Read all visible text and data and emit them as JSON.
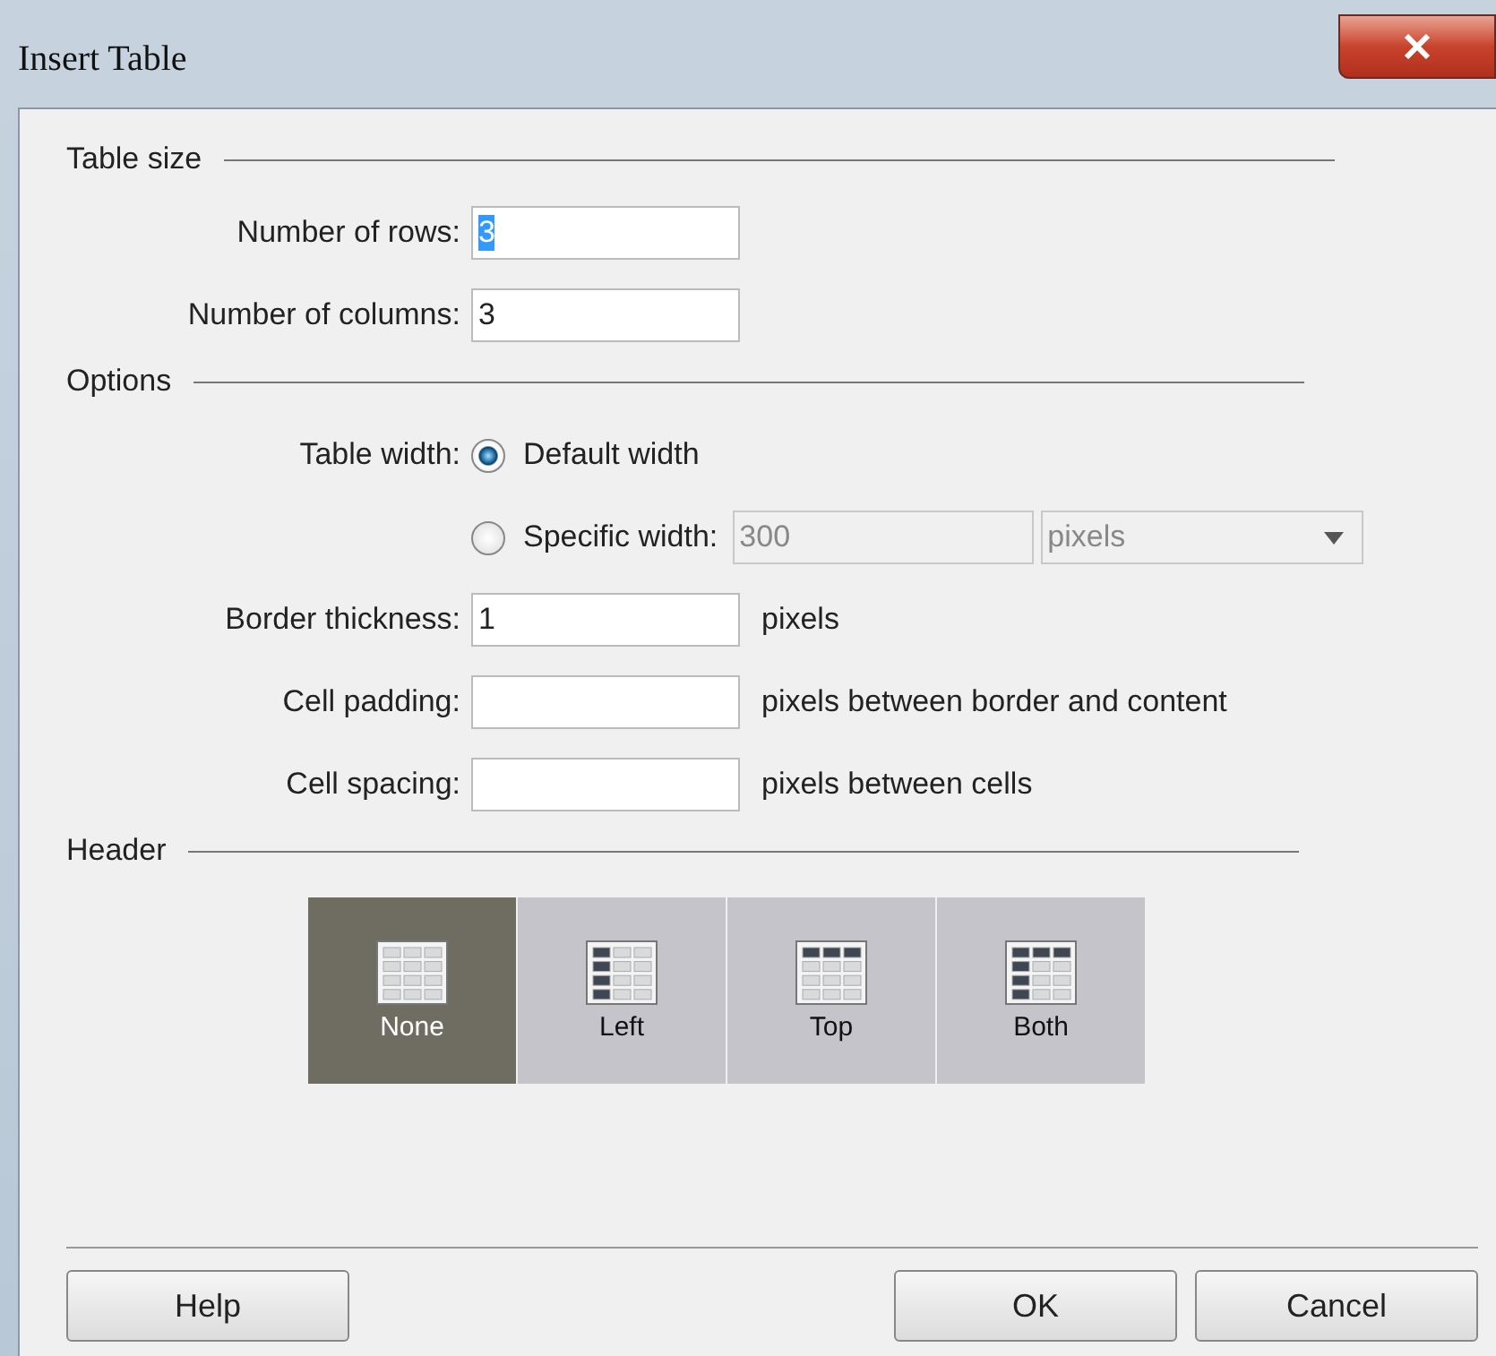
{
  "window": {
    "title": "Insert Table"
  },
  "table_size": {
    "heading": "Table size",
    "fields": [
      {
        "label": "Number of rows:",
        "value": "3",
        "highlighted": true
      },
      {
        "label": "Number of columns:",
        "value": "3",
        "highlighted": false
      }
    ]
  },
  "options": {
    "heading": "Options",
    "table_width_label": "Table width:",
    "width_choices": [
      {
        "label": "Default width",
        "selected": true
      },
      {
        "label": "Specific width:",
        "selected": false
      }
    ],
    "specific_width": {
      "value": "300",
      "disabled": true
    },
    "width_unit": {
      "value": "pixels",
      "disabled": true
    },
    "fields": [
      {
        "label": "Border thickness:",
        "value": "1",
        "unit": "pixels"
      },
      {
        "label": "Cell padding:",
        "unit": "pixels between border and content"
      },
      {
        "label": "Cell spacing:",
        "unit": "pixels between cells"
      }
    ]
  },
  "header": {
    "heading": "Header",
    "choices": [
      {
        "label": "None",
        "kind": "none",
        "selected": true
      },
      {
        "label": "Left",
        "kind": "left",
        "selected": false
      },
      {
        "label": "Top",
        "kind": "top",
        "selected": false
      },
      {
        "label": "Both",
        "kind": "both",
        "selected": false
      }
    ]
  },
  "buttons": {
    "left": [
      "Help"
    ],
    "right": [
      "OK",
      "Cancel"
    ]
  }
}
